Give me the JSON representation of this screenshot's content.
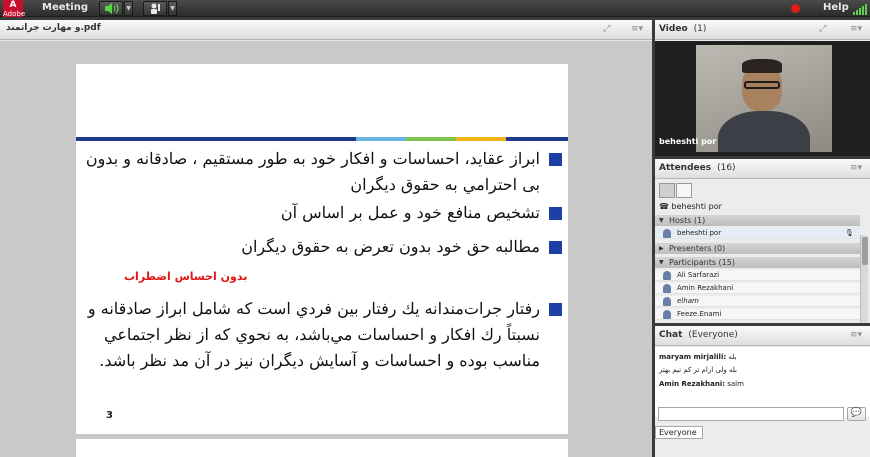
{
  "topbar": {
    "logo_text": "Adobe",
    "meeting_menu": "Meeting",
    "help_menu": "Help"
  },
  "share": {
    "title": "و مهارت جراتمند.pdf",
    "slide": {
      "bar_colors": [
        "#1f3b8f",
        "#1f3b8f",
        "#6cb4e4",
        "#7ec24d",
        "#f0b41b",
        "#1f3b8f"
      ],
      "bullets": [
        "ابراز عقايد، احساسات و افكار خود به طور مستقيم ، صادقانه و بدون بی احترامي به حقوق ديگران",
        "تشخيص منافع خود و عمل بر اساس آن",
        "مطالبه حق خود بدون تعرض به حقوق ديگران",
        "رفتار جرات‌مندانه يك رفتار بين فردي است كه شامل ابراز صادقانه و نسبتاً رك افكار و احساسات مي‌باشد، به نحوي كه از نظر اجتماعي مناسب بوده و احساسات و آسايش ديگران نيز در آن مد نظر باشد."
      ],
      "subtitle": "بدون احساس اضطراب",
      "page_number": "3",
      "bullet_color": "#1e3fa5",
      "subtitle_color": "#e21616"
    }
  },
  "video": {
    "title": "Video",
    "count": "(1)",
    "name_label": "beheshti por"
  },
  "attendees": {
    "title": "Attendees",
    "count": "(16)",
    "self_name": "beheshti por",
    "hosts_label": "Hosts (1)",
    "hosts": [
      "beheshti por"
    ],
    "presenters_label": "Presenters (0)",
    "participants_label": "Participants (15)",
    "participants": [
      "Ali Sarfarazi",
      "Amin Rezakhani",
      "elham",
      "Feeze.Enami"
    ]
  },
  "chat": {
    "title": "Chat",
    "scope": "(Everyone)",
    "messages": [
      {
        "sender": "maryam mirjalili:",
        "text": "بله"
      },
      {
        "sender": "",
        "text": "بله ولی ارام تر کم تیم بهتر"
      },
      {
        "sender": "Amin Rezakhani:",
        "text": "salm"
      }
    ],
    "input_value": "",
    "tab_label": "Everyone"
  }
}
